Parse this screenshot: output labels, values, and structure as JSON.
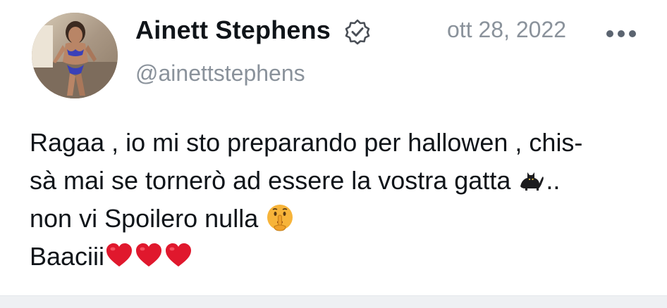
{
  "post": {
    "author": {
      "display_name": "Ainett Stephens",
      "handle": "@ainettstephens",
      "verified": true
    },
    "timestamp": "ott 28, 2022",
    "more_icon": "more-horizontal-icon",
    "text_lines": [
      "Ragaa , io mi sto preparando per hallowen , chis-",
      "sà mai se tornerò ad essere la vostra gatta",
      "..",
      "non vi Spoilero nulla",
      "Baaciii"
    ],
    "emojis": [
      "black-cat-emoji",
      "shushing-face-emoji",
      "red-heart-emoji",
      "red-heart-emoji",
      "red-heart-emoji"
    ]
  },
  "colors": {
    "text_primary": "#0f1419",
    "text_secondary": "#8a929b",
    "heart": "#e0182d",
    "shush_face": "#f7b43a"
  }
}
